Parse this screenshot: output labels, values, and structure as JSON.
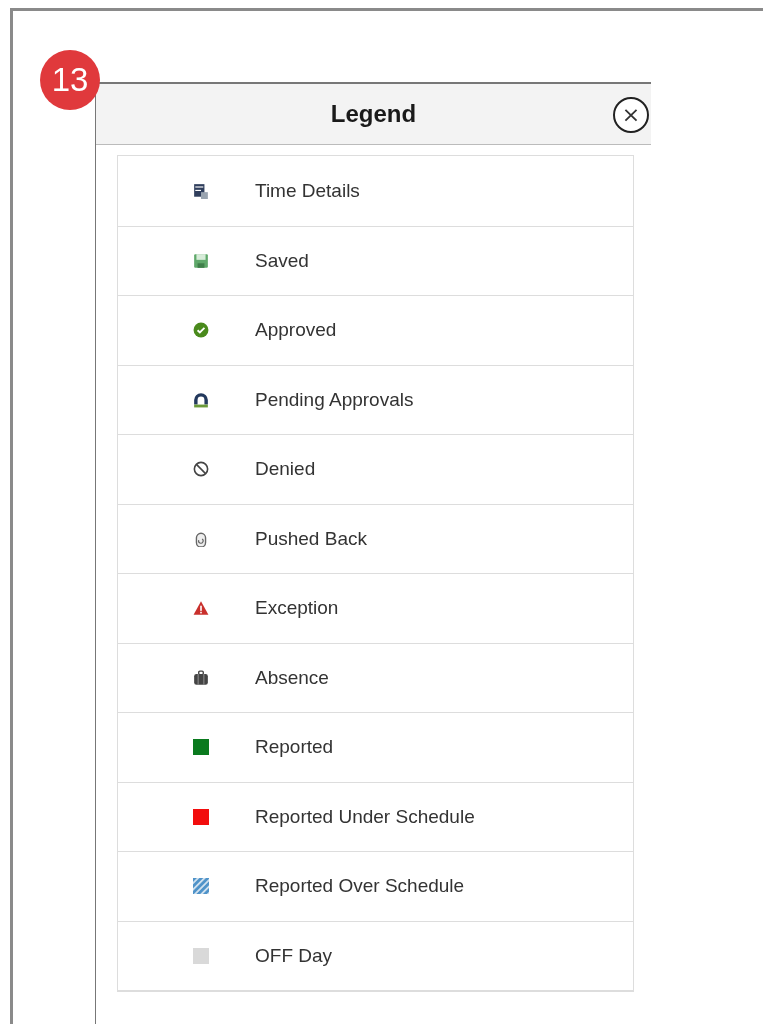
{
  "step_badge": "13",
  "dialog": {
    "title": "Legend",
    "close_label": "×"
  },
  "items": [
    {
      "kind": "details",
      "label": "Time Details"
    },
    {
      "kind": "saved",
      "label": "Saved"
    },
    {
      "kind": "approved",
      "label": "Approved"
    },
    {
      "kind": "pending",
      "label": "Pending Approvals"
    },
    {
      "kind": "denied",
      "label": "Denied"
    },
    {
      "kind": "pushed",
      "label": "Pushed Back"
    },
    {
      "kind": "exception",
      "label": "Exception"
    },
    {
      "kind": "absence",
      "label": "Absence"
    },
    {
      "kind": "swatch",
      "label": "Reported",
      "color": "#0a7a1e"
    },
    {
      "kind": "swatch",
      "label": "Reported Under Schedule",
      "color": "#f20d0d"
    },
    {
      "kind": "hatch",
      "label": "Reported Over Schedule",
      "color": "#4f93c9"
    },
    {
      "kind": "swatch",
      "label": "OFF Day",
      "color": "#d9d9d9"
    }
  ]
}
